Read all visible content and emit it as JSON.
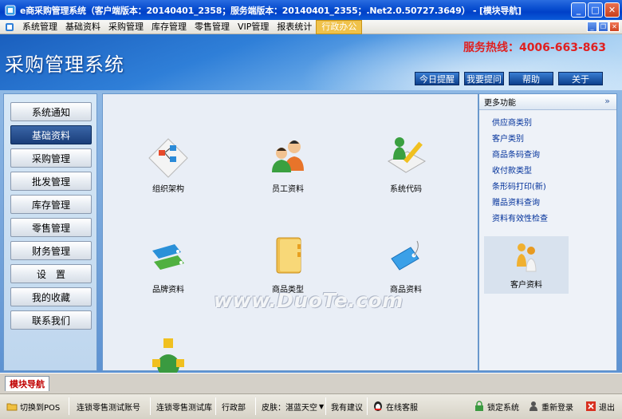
{
  "window": {
    "title": "e商采购管理系统（客户端版本：20140401_2358；服务端版本：20140401_2355；.Net2.0.50727.3649） - [模块导航]",
    "buttons": [
      "_",
      "□",
      "✕"
    ]
  },
  "menu": {
    "items": [
      "系统管理",
      "基础资料",
      "采购管理",
      "库存管理",
      "零售管理",
      "VIP管理",
      "报表统计",
      "行政办公"
    ],
    "active_index": 7
  },
  "banner": {
    "title": "采购管理系统",
    "hotline": "服务热线：4006-663-863",
    "buttons": [
      "今日提醒",
      "我要提问",
      "帮助",
      "关于"
    ]
  },
  "left_nav": {
    "items": [
      "系统通知",
      "基础资料",
      "采购管理",
      "批发管理",
      "库存管理",
      "零售管理",
      "财务管理",
      "设　置",
      "我的收藏",
      "联系我们"
    ],
    "selected_index": 1
  },
  "center": {
    "tiles": [
      {
        "label": "组织架构",
        "icon": "org-chart-icon"
      },
      {
        "label": "员工资料",
        "icon": "employees-icon"
      },
      {
        "label": "系统代码",
        "icon": "system-code-icon"
      },
      {
        "label": "品牌资料",
        "icon": "brand-tags-icon"
      },
      {
        "label": "商品类型",
        "icon": "folder-icon"
      },
      {
        "label": "商品资料",
        "icon": "product-tag-icon"
      },
      {
        "label": "",
        "icon": "network-globe-icon"
      }
    ],
    "watermark": "www.DuoTe.com"
  },
  "right_panel": {
    "header": "更多功能",
    "chevron": "»",
    "links": [
      "供应商类别",
      "客户类别",
      "商品条码查询",
      "收付款类型",
      "条形码打印(新)",
      "赠品资料查询",
      "资料有效性检查"
    ],
    "tile": {
      "label": "客户资料",
      "icon": "customers-icon"
    }
  },
  "tabs": {
    "module_tab": "模块导航"
  },
  "statusbar": {
    "items": [
      "切换到POS",
      "连锁零售测试账号",
      "连锁零售测试库",
      "行政部",
      "皮肤：湛蓝天空",
      "我有建议",
      "在线客服",
      "锁定系统",
      "重新登录",
      "退出"
    ]
  },
  "colors": {
    "title_bar": "#0a4fd0",
    "banner_blue": "#2f7fd8",
    "hotline_red": "#e02020",
    "nav_selected": "#1a3e7a",
    "link_blue": "#00309a"
  }
}
